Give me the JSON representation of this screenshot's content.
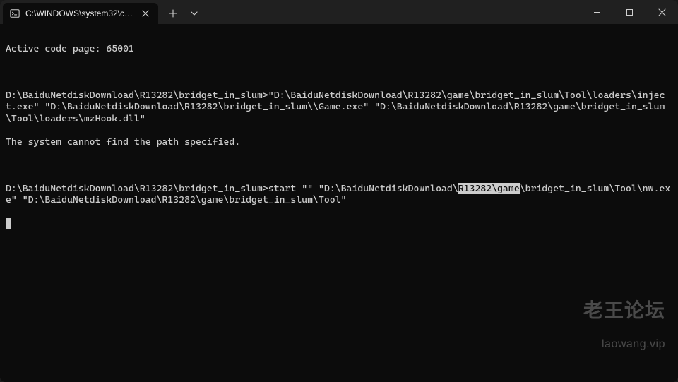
{
  "tab": {
    "title": "C:\\WINDOWS\\system32\\cmd."
  },
  "terminal": {
    "line_codepage": "Active code page: 65001",
    "block1": {
      "prompt": "D:\\BaiduNetdiskDownload\\R13282\\bridget_in_slum>",
      "cmd": "\"D:\\BaiduNetdiskDownload\\R13282\\game\\bridget_in_slum\\Tool\\loaders\\inject.exe\" \"D:\\BaiduNetdiskDownload\\R13282\\bridget_in_slum\\\\Game.exe\" \"D:\\BaiduNetdiskDownload\\R13282\\game\\bridget_in_slum\\Tool\\loaders\\mzHook.dll\"",
      "error": "The system cannot find the path specified."
    },
    "block2": {
      "prompt": "D:\\BaiduNetdiskDownload\\R13282\\bridget_in_slum>",
      "cmd_pre": "start \"\" \"D:\\BaiduNetdiskDownload\\",
      "cmd_hl": "R13282\\game",
      "cmd_post": "\\bridget_in_slum\\Tool\\nw.exe\" \"D:\\BaiduNetdiskDownload\\R13282\\game\\bridget_in_slum\\Tool\""
    }
  },
  "watermark": {
    "line1": "老王论坛",
    "line2": "laowang.vip"
  }
}
